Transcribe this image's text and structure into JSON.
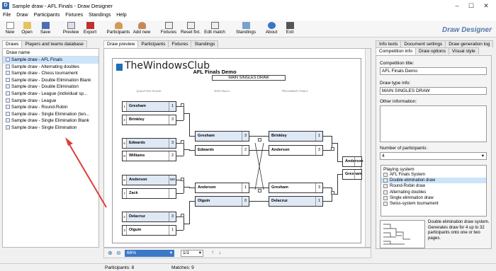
{
  "window": {
    "title": "Sample draw - AFL Finals - Draw Designer"
  },
  "menu": [
    "File",
    "Draw",
    "Participants",
    "Fixtures",
    "Standings",
    "Help"
  ],
  "toolbar": {
    "new": "New",
    "open": "Open",
    "save": "Save",
    "preview": "Preview",
    "export": "Export",
    "participants": "Participants",
    "add_new": "Add new",
    "fixtures": "Fixtures",
    "reset_fixt": "Reset fixt.",
    "edit_match": "Edit match",
    "standings": "Standings",
    "about": "About",
    "exit": "Exit"
  },
  "brand": "Draw Designer",
  "left": {
    "tabs": [
      "Draws",
      "Players and teams database"
    ],
    "header": "Draw name",
    "items": [
      "Sample draw - AFL Finals",
      "Sample draw - Alternating doubles",
      "Sample draw - Chess tournament",
      "Sample draw - Double Elimination Blank",
      "Sample draw - Double Elimination",
      "Sample draw - League (individual sp...",
      "Sample draw - League",
      "Sample draw - Round-Robin",
      "Sample draw - Single Elimination (ten...",
      "Sample draw - Single Elimination Blank",
      "Sample draw - Single Elimination"
    ]
  },
  "center": {
    "tabs": [
      "Draw preview",
      "Participants",
      "Fixtures",
      "Standings"
    ],
    "zoom": "66%",
    "page": "1/1"
  },
  "sheet": {
    "watermark": "TheWindowsClub",
    "title": "AFL Finals Demo",
    "subtitle": "MAIN SINGLES DRAW",
    "rounds": [
      "QUALIFYING ROUND",
      "SEMI FINALS",
      "PRELIMINARY FINALS"
    ],
    "r1": [
      {
        "seed": "1",
        "name": "Gresham",
        "score": "1",
        "win": true
      },
      {
        "seed": "4",
        "name": "Brinkley",
        "score": "3",
        "win": false
      },
      {
        "seed": "5",
        "name": "Edwards",
        "score": "3",
        "win": true
      },
      {
        "seed": "8",
        "name": "Williams",
        "score": "2",
        "win": false
      },
      {
        "seed": "6",
        "name": "Anderson",
        "score": "wo",
        "win": true
      },
      {
        "seed": "7",
        "name": "Zack",
        "score": "",
        "win": false
      },
      {
        "seed": "2",
        "name": "Delacruz",
        "score": "3",
        "win": true
      },
      {
        "seed": "3",
        "name": "Olguin",
        "score": "1",
        "win": false
      }
    ],
    "r2": [
      {
        "name": "Gresham",
        "score": "3",
        "win": true
      },
      {
        "name": "Edwards",
        "score": "2",
        "win": false
      },
      {
        "name": "Anderson",
        "score": "1",
        "win": false
      },
      {
        "name": "Olguin",
        "score": "0",
        "win": true
      }
    ],
    "r3": [
      {
        "name": "Brinkley",
        "score": "1",
        "win": true
      },
      {
        "name": "Anderson",
        "score": "3",
        "win": false
      },
      {
        "name": "Gresham",
        "score": "3",
        "win": false
      },
      {
        "name": "Delacruz",
        "score": "1",
        "win": true
      }
    ],
    "r4": [
      {
        "name": "Anderson",
        "score": "",
        "win": false
      },
      {
        "name": "Gresham",
        "score": "",
        "win": false
      }
    ]
  },
  "right": {
    "tabs_top": [
      "Info texts",
      "Document settings",
      "Draw generation log"
    ],
    "tabs_bottom": [
      "Competition info",
      "Draw options",
      "Visual style"
    ],
    "competition_title_label": "Competition title:",
    "competition_title": "AFL Finals Demo",
    "draw_type_label": "Draw type info:",
    "draw_type": "MAIN SINGLES DRAW",
    "other_label": "Other information:",
    "participants_label": "Number of participants:",
    "participants": "4",
    "playing_system_label": "Playing system",
    "systems": [
      "AFL Finals System",
      "Double elimination draw",
      "Round-Robin draw",
      "Alternating doubles",
      "Single elimination draw",
      "Swiss-system tournament"
    ],
    "description": "Double elimination draw system. Generates draw for 4 up to 32 participants onto one or two pages."
  },
  "status": {
    "participants": "Participants: 8",
    "matches": "Matches: 9"
  },
  "colors": {
    "selection": "#cde4fa",
    "winner_slot": "#dfe9f5",
    "arrow": "#d9413a"
  }
}
